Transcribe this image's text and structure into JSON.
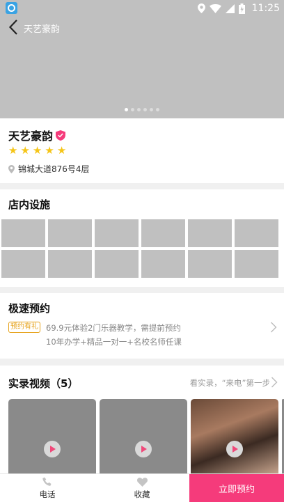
{
  "status_bar": {
    "time": "11:25",
    "icons": [
      "location-icon",
      "wifi-icon",
      "signal-icon",
      "battery-icon"
    ]
  },
  "header": {
    "title": "天艺豪韵",
    "carousel": {
      "page_count": 6,
      "active_index": 0
    }
  },
  "store": {
    "name": "天艺豪韵",
    "rating": 5,
    "address": "锦城大道876号4层"
  },
  "facilities": {
    "title": "店内设施",
    "cells": 12
  },
  "booking": {
    "title": "极速预约",
    "tag": "预约有礼",
    "line1": "69.9元体验2门乐器教学，需提前预约",
    "line2": "10年办学+精品一对一+名校名师任课"
  },
  "videos": {
    "title": "实录视频（",
    "count": "5",
    "title_end": "）",
    "more": "看实录，“来电”第一步"
  },
  "bottom_bar": {
    "phone_label": "电话",
    "favorite_label": "收藏",
    "book_label": "立即预约"
  },
  "colors": {
    "accent": "#f53b7b",
    "star": "#f5c518",
    "tag": "#e6a117"
  }
}
